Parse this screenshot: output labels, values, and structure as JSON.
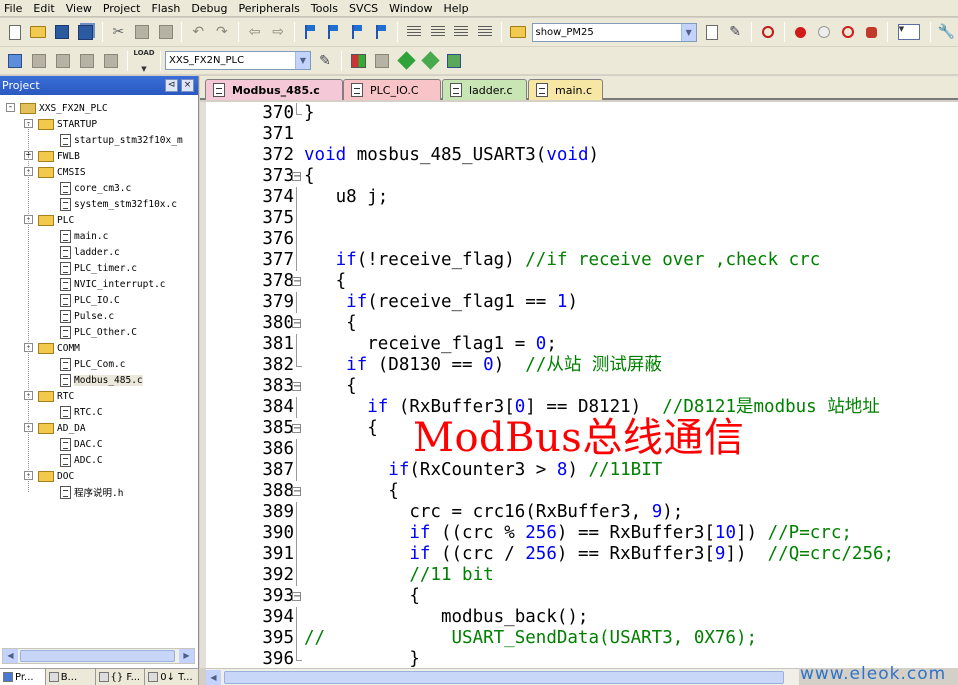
{
  "menu": [
    "File",
    "Edit",
    "View",
    "Project",
    "Flash",
    "Debug",
    "Peripherals",
    "Tools",
    "SVCS",
    "Window",
    "Help"
  ],
  "toolbar": {
    "target_combo": "show_PM25",
    "project_combo": "XXS_FX2N_PLC",
    "load_label": "LOAD"
  },
  "project_panel": {
    "title": "Project",
    "tree": [
      {
        "label": "XXS_FX2N_PLC",
        "level": 0,
        "type": "root",
        "expander": "-"
      },
      {
        "label": "STARTUP",
        "level": 1,
        "type": "folder",
        "expander": "-"
      },
      {
        "label": "startup_stm32f10x_m",
        "level": 2,
        "type": "file"
      },
      {
        "label": "FWLB",
        "level": 1,
        "type": "folder",
        "expander": "+"
      },
      {
        "label": "CMSIS",
        "level": 1,
        "type": "folder",
        "expander": "-"
      },
      {
        "label": "core_cm3.c",
        "level": 2,
        "type": "file"
      },
      {
        "label": "system_stm32f10x.c",
        "level": 2,
        "type": "file"
      },
      {
        "label": "PLC",
        "level": 1,
        "type": "folder",
        "expander": "-"
      },
      {
        "label": "main.c",
        "level": 2,
        "type": "file"
      },
      {
        "label": "ladder.c",
        "level": 2,
        "type": "file"
      },
      {
        "label": "PLC_timer.c",
        "level": 2,
        "type": "file"
      },
      {
        "label": "NVIC_interrupt.c",
        "level": 2,
        "type": "file"
      },
      {
        "label": "PLC_IO.C",
        "level": 2,
        "type": "file"
      },
      {
        "label": "Pulse.c",
        "level": 2,
        "type": "file"
      },
      {
        "label": "PLC_Other.C",
        "level": 2,
        "type": "file"
      },
      {
        "label": "COMM",
        "level": 1,
        "type": "folder",
        "expander": "-"
      },
      {
        "label": "PLC_Com.c",
        "level": 2,
        "type": "file"
      },
      {
        "label": "Modbus_485.c",
        "level": 2,
        "type": "file",
        "selected": true
      },
      {
        "label": "RTC",
        "level": 1,
        "type": "folder",
        "expander": "-"
      },
      {
        "label": "RTC.C",
        "level": 2,
        "type": "file"
      },
      {
        "label": "AD_DA",
        "level": 1,
        "type": "folder",
        "expander": "-"
      },
      {
        "label": "DAC.C",
        "level": 2,
        "type": "file"
      },
      {
        "label": "ADC.C",
        "level": 2,
        "type": "file"
      },
      {
        "label": "DOC",
        "level": 1,
        "type": "folder",
        "expander": "-"
      },
      {
        "label": "程序说明.h",
        "level": 2,
        "type": "file"
      }
    ]
  },
  "bottom_tabs": [
    "Pr...",
    "B...",
    "{} F...",
    "0↓ T..."
  ],
  "file_tabs": [
    {
      "label": "Modbus_485.c",
      "color": "#f5c8d8",
      "active": true
    },
    {
      "label": "PLC_IO.C",
      "color": "#f8c4c8",
      "active": false
    },
    {
      "label": "ladder.c",
      "color": "#c8e6b4",
      "active": false
    },
    {
      "label": "main.c",
      "color": "#f7e7a4",
      "active": false
    }
  ],
  "code_lines": [
    {
      "n": "370",
      "fold": "end",
      "tokens": [
        {
          "t": "}",
          "c": ""
        }
      ]
    },
    {
      "n": "371",
      "fold": "",
      "tokens": []
    },
    {
      "n": "372",
      "fold": "",
      "tokens": [
        {
          "t": "void",
          "c": "kw"
        },
        {
          "t": " mosbus_485_USART3(",
          "c": ""
        },
        {
          "t": "void",
          "c": "kw"
        },
        {
          "t": ")",
          "c": ""
        }
      ]
    },
    {
      "n": "373",
      "fold": "open",
      "tokens": [
        {
          "t": "{",
          "c": ""
        }
      ]
    },
    {
      "n": "374",
      "fold": "line",
      "tokens": [
        {
          "t": "   u8 j;",
          "c": ""
        }
      ]
    },
    {
      "n": "375",
      "fold": "line",
      "tokens": []
    },
    {
      "n": "376",
      "fold": "line",
      "tokens": []
    },
    {
      "n": "377",
      "fold": "line",
      "tokens": [
        {
          "t": "   ",
          "c": ""
        },
        {
          "t": "if",
          "c": "kw"
        },
        {
          "t": "(!receive_flag) ",
          "c": ""
        },
        {
          "t": "//if receive over ,check crc",
          "c": "cm"
        }
      ]
    },
    {
      "n": "378",
      "fold": "open",
      "tokens": [
        {
          "t": "   {",
          "c": ""
        }
      ]
    },
    {
      "n": "379",
      "fold": "line",
      "tokens": [
        {
          "t": "    ",
          "c": ""
        },
        {
          "t": "if",
          "c": "kw"
        },
        {
          "t": "(receive_flag1 == ",
          "c": ""
        },
        {
          "t": "1",
          "c": "nm"
        },
        {
          "t": ")",
          "c": ""
        }
      ]
    },
    {
      "n": "380",
      "fold": "open",
      "tokens": [
        {
          "t": "    {",
          "c": ""
        }
      ]
    },
    {
      "n": "381",
      "fold": "line",
      "tokens": [
        {
          "t": "      receive_flag1 = ",
          "c": ""
        },
        {
          "t": "0",
          "c": "nm"
        },
        {
          "t": ";",
          "c": ""
        }
      ]
    },
    {
      "n": "382",
      "fold": "end",
      "tokens": [
        {
          "t": "    ",
          "c": ""
        },
        {
          "t": "if",
          "c": "kw"
        },
        {
          "t": " (D8130 == ",
          "c": ""
        },
        {
          "t": "0",
          "c": "nm"
        },
        {
          "t": ")  ",
          "c": ""
        },
        {
          "t": "//从站 测试屏蔽",
          "c": "cm"
        }
      ]
    },
    {
      "n": "383",
      "fold": "open",
      "tokens": [
        {
          "t": "    {",
          "c": ""
        }
      ]
    },
    {
      "n": "384",
      "fold": "line",
      "tokens": [
        {
          "t": "      ",
          "c": ""
        },
        {
          "t": "if",
          "c": "kw"
        },
        {
          "t": " (RxBuffer3[",
          "c": ""
        },
        {
          "t": "0",
          "c": "nm"
        },
        {
          "t": "] == D8121)  ",
          "c": ""
        },
        {
          "t": "//D8121是modbus 站地址",
          "c": "cm"
        }
      ]
    },
    {
      "n": "385",
      "fold": "open",
      "tokens": [
        {
          "t": "      {",
          "c": ""
        }
      ]
    },
    {
      "n": "386",
      "fold": "line",
      "tokens": []
    },
    {
      "n": "387",
      "fold": "line",
      "tokens": [
        {
          "t": "        ",
          "c": ""
        },
        {
          "t": "if",
          "c": "kw"
        },
        {
          "t": "(RxCounter3 > ",
          "c": ""
        },
        {
          "t": "8",
          "c": "nm"
        },
        {
          "t": ") ",
          "c": ""
        },
        {
          "t": "//11BIT",
          "c": "cm"
        }
      ]
    },
    {
      "n": "388",
      "fold": "open",
      "tokens": [
        {
          "t": "        {",
          "c": ""
        }
      ]
    },
    {
      "n": "389",
      "fold": "line",
      "tokens": [
        {
          "t": "          crc = crc16(RxBuffer3, ",
          "c": ""
        },
        {
          "t": "9",
          "c": "nm"
        },
        {
          "t": ");",
          "c": ""
        }
      ]
    },
    {
      "n": "390",
      "fold": "line",
      "tokens": [
        {
          "t": "          ",
          "c": ""
        },
        {
          "t": "if",
          "c": "kw"
        },
        {
          "t": " ((crc % ",
          "c": ""
        },
        {
          "t": "256",
          "c": "nm"
        },
        {
          "t": ") == RxBuffer3[",
          "c": ""
        },
        {
          "t": "10",
          "c": "nm"
        },
        {
          "t": "]) ",
          "c": ""
        },
        {
          "t": "//P=crc;",
          "c": "cm"
        }
      ]
    },
    {
      "n": "391",
      "fold": "line",
      "tokens": [
        {
          "t": "          ",
          "c": ""
        },
        {
          "t": "if",
          "c": "kw"
        },
        {
          "t": " ((crc / ",
          "c": ""
        },
        {
          "t": "256",
          "c": "nm"
        },
        {
          "t": ") == RxBuffer3[",
          "c": ""
        },
        {
          "t": "9",
          "c": "nm"
        },
        {
          "t": "])  ",
          "c": ""
        },
        {
          "t": "//Q=crc/256;",
          "c": "cm"
        }
      ]
    },
    {
      "n": "392",
      "fold": "line",
      "tokens": [
        {
          "t": "          ",
          "c": ""
        },
        {
          "t": "//11 bit",
          "c": "cm"
        }
      ]
    },
    {
      "n": "393",
      "fold": "open",
      "tokens": [
        {
          "t": "          {",
          "c": ""
        }
      ]
    },
    {
      "n": "394",
      "fold": "line",
      "tokens": [
        {
          "t": "             modbus_back();",
          "c": ""
        }
      ]
    },
    {
      "n": "395",
      "fold": "line",
      "tokens": [
        {
          "t": "//            USART_SendData(USART3, 0X76);",
          "c": "cm"
        }
      ]
    },
    {
      "n": "396",
      "fold": "end",
      "tokens": [
        {
          "t": "          }",
          "c": ""
        }
      ]
    }
  ],
  "overlay_caption": "ModBus总线通信",
  "watermark": "www.eleok.com"
}
